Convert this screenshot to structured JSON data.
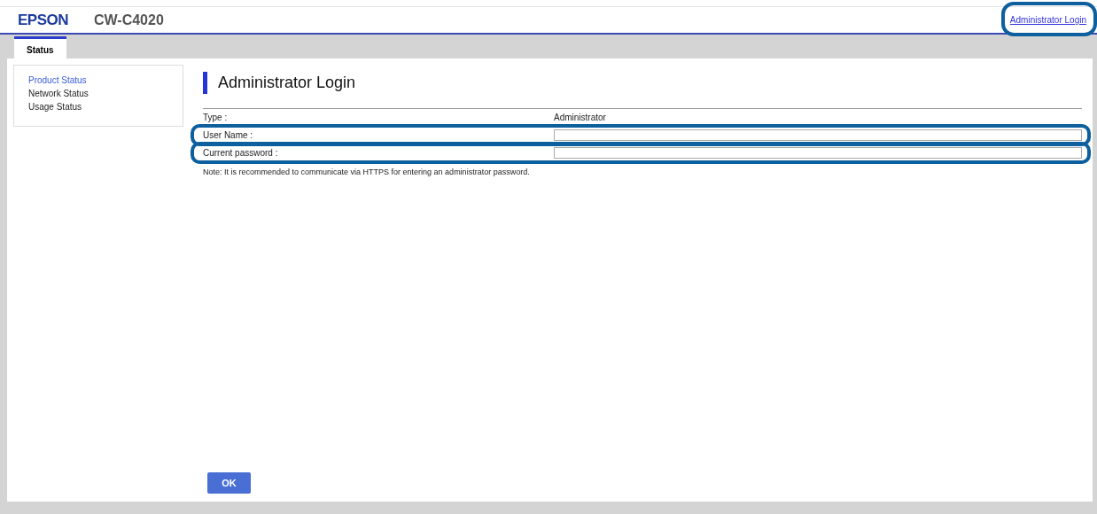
{
  "header": {
    "logo": "EPSON",
    "model": "CW-C4020",
    "login_link": "Administrator Login"
  },
  "tabs": [
    {
      "label": "Status",
      "selected": true
    }
  ],
  "sidebar": {
    "items": [
      {
        "label": "Product Status",
        "selected": true
      },
      {
        "label": "Network Status",
        "selected": false
      },
      {
        "label": "Usage Status",
        "selected": false
      }
    ]
  },
  "main": {
    "title": "Administrator Login",
    "rows": [
      {
        "kind": "text",
        "label": "Type :",
        "value": "Administrator"
      },
      {
        "kind": "input",
        "label": "User Name :",
        "highlighted": true
      },
      {
        "kind": "input",
        "label": "Current password :",
        "highlighted": true
      }
    ],
    "note": "Note: It is recommended to communicate via HTTPS for entering an administrator password.",
    "ok_button": "OK"
  }
}
